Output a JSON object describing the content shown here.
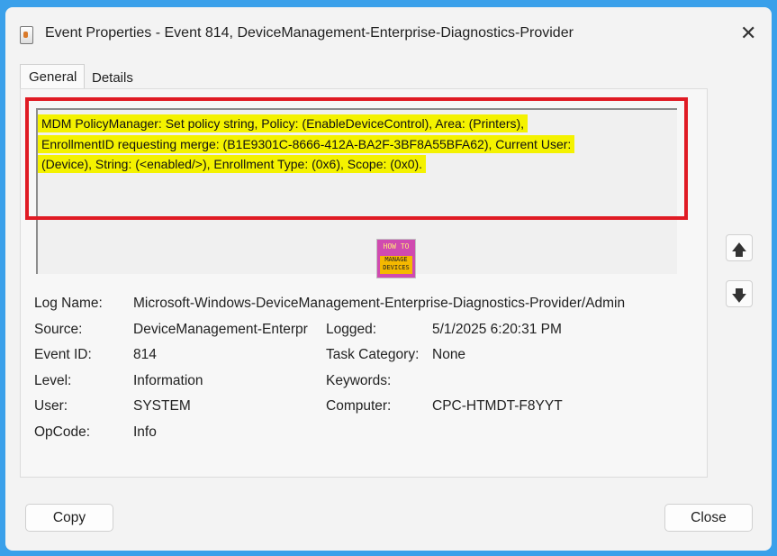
{
  "window": {
    "title": "Event Properties - Event 814, DeviceManagement-Enterprise-Diagnostics-Provider",
    "close_glyph": "✕"
  },
  "tabs": [
    {
      "label": "General",
      "selected": true
    },
    {
      "label": "Details",
      "selected": false
    }
  ],
  "description": {
    "line1": "MDM PolicyManager: Set policy string, Policy: (EnableDeviceControl), Area: (Printers),",
    "line2": "EnrollmentID requesting merge: (B1E9301C-8666-412A-BA2F-3BF8A55BFA62), Current User:",
    "line3": "(Device), String: (<enabled/>), Enrollment Type: (0x6), Scope: (0x0)."
  },
  "watermark": {
    "line1": "HOW TO",
    "line2a": "MANAGE",
    "line2b": "DEVICES"
  },
  "nav": {
    "up_glyph": "🡅",
    "down_glyph": "🡇"
  },
  "properties": {
    "log_name": {
      "label": "Log Name:",
      "value": "Microsoft-Windows-DeviceManagement-Enterprise-Diagnostics-Provider/Admin"
    },
    "source": {
      "label": "Source:",
      "value": "DeviceManagement-Enterpr"
    },
    "logged": {
      "label": "Logged:",
      "value": "5/1/2025 6:20:31 PM"
    },
    "event_id": {
      "label": "Event ID:",
      "value": "814"
    },
    "task_category": {
      "label": "Task Category:",
      "value": "None"
    },
    "level": {
      "label": "Level:",
      "value": "Information"
    },
    "keywords": {
      "label": "Keywords:",
      "value": ""
    },
    "user": {
      "label": "User:",
      "value": "SYSTEM"
    },
    "computer": {
      "label": "Computer:",
      "value": "CPC-HTMDT-F8YYT"
    },
    "opcode": {
      "label": "OpCode:",
      "value": "Info"
    }
  },
  "buttons": {
    "copy": "Copy",
    "close": "Close"
  },
  "colors": {
    "highlight": "#f4f200",
    "annotation_box": "#e01b24",
    "background": "#3aa0ea"
  }
}
